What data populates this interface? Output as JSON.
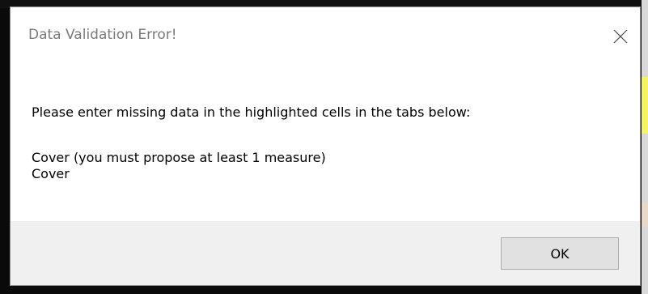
{
  "dialog": {
    "title": "Data Validation Error!",
    "close_icon": "close-icon",
    "message": {
      "line1": "Please enter missing data in the highlighted cells in the tabs below:",
      "line2": "Cover (you must propose at least 1 measure)",
      "line3": "Cover"
    },
    "ok_label": "OK"
  },
  "colors": {
    "dialog_background": "#ffffff",
    "footer_background": "#f0f0f0",
    "button_background": "#e1e1e1",
    "title_color": "#7a7a7a"
  }
}
